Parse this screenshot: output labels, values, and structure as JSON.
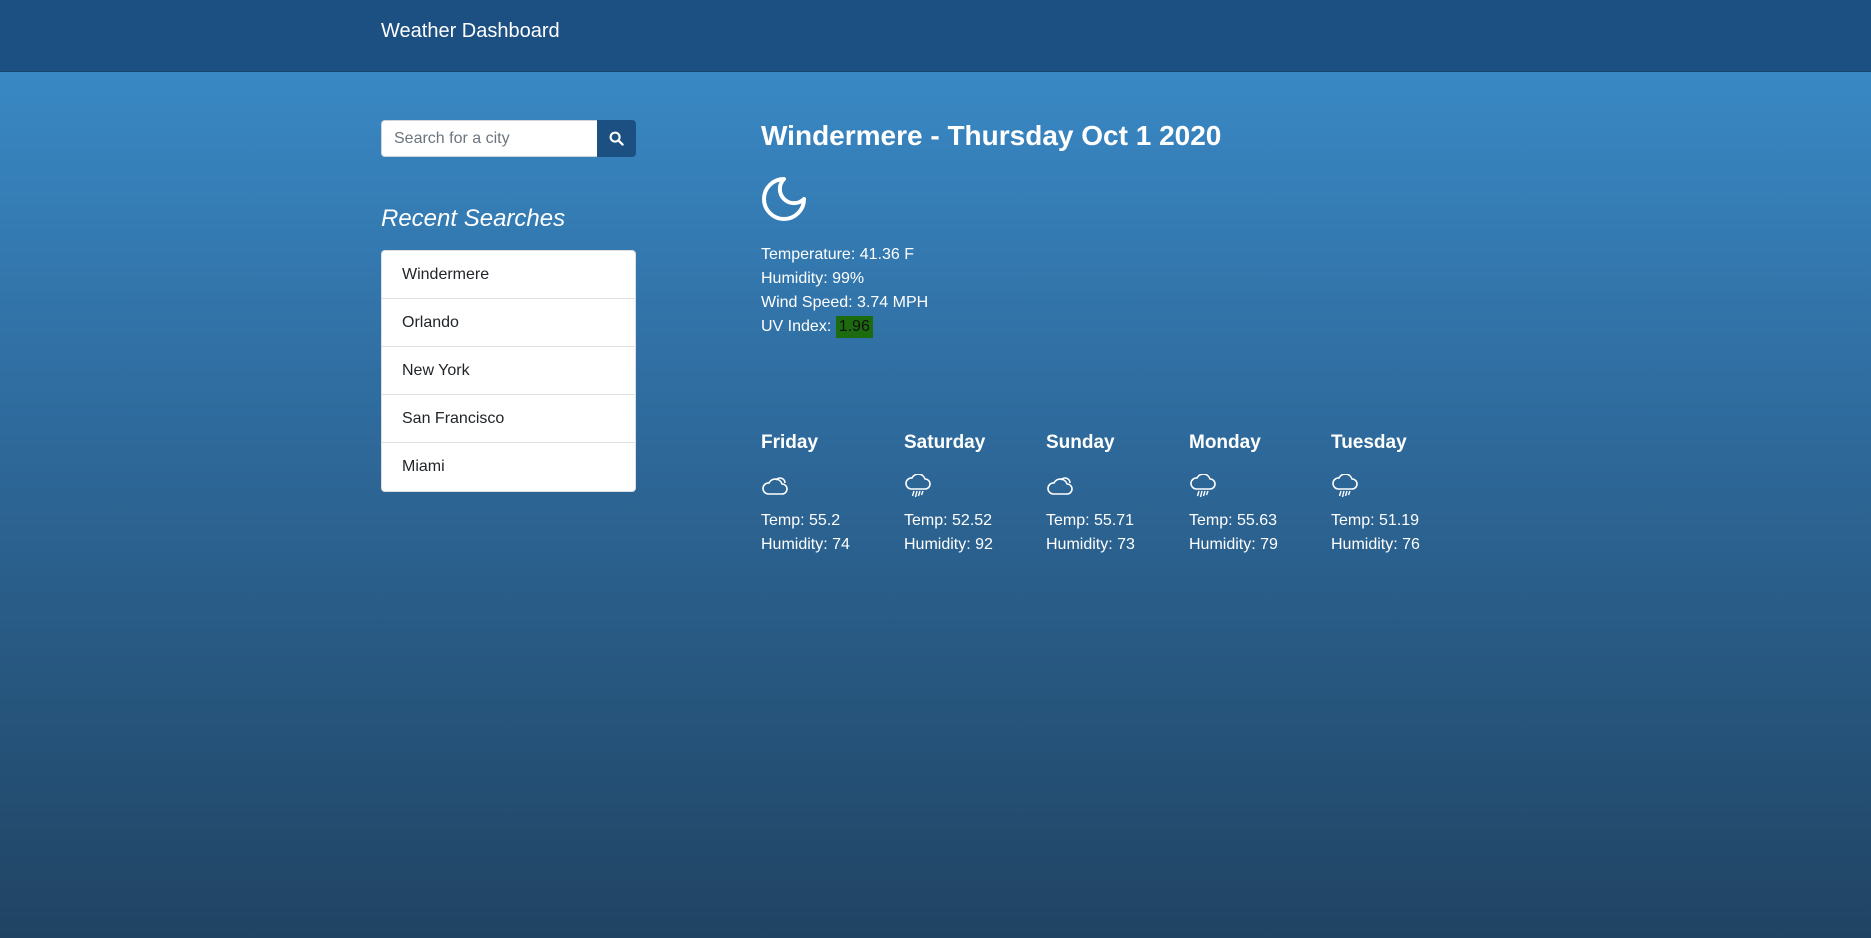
{
  "app": {
    "title": "Weather Dashboard"
  },
  "search": {
    "placeholder": "Search for a city",
    "button_icon": "search-icon"
  },
  "recent": {
    "heading": "Recent Searches",
    "items": [
      {
        "label": "Windermere"
      },
      {
        "label": "Orlando"
      },
      {
        "label": "New York"
      },
      {
        "label": "San Francisco"
      },
      {
        "label": "Miami"
      }
    ]
  },
  "current": {
    "title": "Windermere - Thursday Oct 1 2020",
    "icon": "moon-icon",
    "temperature": "Temperature: 41.36 F",
    "humidity": "Humidity: 99%",
    "wind": "Wind Speed: 3.74 MPH",
    "uv_label": "UV Index: ",
    "uv_value": "1.96",
    "uv_color": "#1c6b0f"
  },
  "forecast": [
    {
      "day": "Friday",
      "icon": "cloud-icon",
      "temp": "Temp: 55.2",
      "humidity": "Humidity: 74"
    },
    {
      "day": "Saturday",
      "icon": "rain-cloud-icon",
      "temp": "Temp: 52.52",
      "humidity": "Humidity: 92"
    },
    {
      "day": "Sunday",
      "icon": "cloud-icon",
      "temp": "Temp: 55.71",
      "humidity": "Humidity: 73"
    },
    {
      "day": "Monday",
      "icon": "rain-cloud-icon",
      "temp": "Temp: 55.63",
      "humidity": "Humidity: 79"
    },
    {
      "day": "Tuesday",
      "icon": "rain-cloud-icon",
      "temp": "Temp: 51.19",
      "humidity": "Humidity: 76"
    }
  ],
  "colors": {
    "navbar": "#1c4f82",
    "gradient_top": "#3988c4",
    "gradient_bottom": "#204363",
    "search_button": "#1c4f82"
  }
}
